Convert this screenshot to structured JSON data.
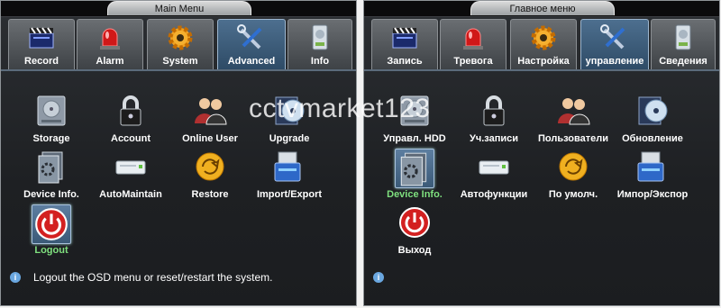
{
  "watermark": "cctvmarket123",
  "panels": [
    {
      "title": "Main Menu",
      "tabs": [
        {
          "label": "Record",
          "icon": "clapperboard-icon",
          "active": false
        },
        {
          "label": "Alarm",
          "icon": "alarm-siren-icon",
          "active": false
        },
        {
          "label": "System",
          "icon": "gear-icon",
          "active": false
        },
        {
          "label": "Advanced",
          "icon": "wrench-screwdriver-icon",
          "active": true
        },
        {
          "label": "Info",
          "icon": "hard-drive-info-icon",
          "active": false
        }
      ],
      "items": [
        {
          "label": "Storage",
          "icon": "hard-drive-icon",
          "selected": false
        },
        {
          "label": "Account",
          "icon": "lock-icon",
          "selected": false
        },
        {
          "label": "Online User",
          "icon": "users-icon",
          "selected": false
        },
        {
          "label": "Upgrade",
          "icon": "disc-upgrade-icon",
          "selected": false
        },
        {
          "label": "Device Info.",
          "icon": "device-info-icon",
          "selected": false
        },
        {
          "label": "AutoMaintain",
          "icon": "maintenance-device-icon",
          "selected": false
        },
        {
          "label": "Restore",
          "icon": "restore-arrows-icon",
          "selected": false
        },
        {
          "label": "Import/Export",
          "icon": "usb-drive-icon",
          "selected": false
        },
        {
          "label": "Logout",
          "icon": "power-icon",
          "selected": true
        }
      ],
      "status": "Logout the OSD menu or reset/restart the system."
    },
    {
      "title": "Главное меню",
      "tabs": [
        {
          "label": "Запись",
          "icon": "clapperboard-icon",
          "active": false
        },
        {
          "label": "Тревога",
          "icon": "alarm-siren-icon",
          "active": false
        },
        {
          "label": "Настройка",
          "icon": "gear-icon",
          "active": false
        },
        {
          "label": "управление",
          "icon": "wrench-screwdriver-icon",
          "active": true
        },
        {
          "label": "Сведения",
          "icon": "hard-drive-info-icon",
          "active": false
        }
      ],
      "items": [
        {
          "label": "Управл. HDD",
          "icon": "hard-drive-icon",
          "selected": false
        },
        {
          "label": "Уч.записи",
          "icon": "lock-icon",
          "selected": false
        },
        {
          "label": "Пользователи",
          "icon": "users-icon",
          "selected": false
        },
        {
          "label": "Обновление",
          "icon": "disc-upgrade-icon",
          "selected": false
        },
        {
          "label": "Device Info.",
          "icon": "device-info-icon",
          "selected": true
        },
        {
          "label": "Автофункции",
          "icon": "maintenance-device-icon",
          "selected": false
        },
        {
          "label": "По умолч.",
          "icon": "restore-arrows-icon",
          "selected": false
        },
        {
          "label": "Импор/Экспор",
          "icon": "usb-drive-icon",
          "selected": false
        },
        {
          "label": "Выход",
          "icon": "power-icon",
          "selected": false
        }
      ],
      "status": ""
    }
  ]
}
